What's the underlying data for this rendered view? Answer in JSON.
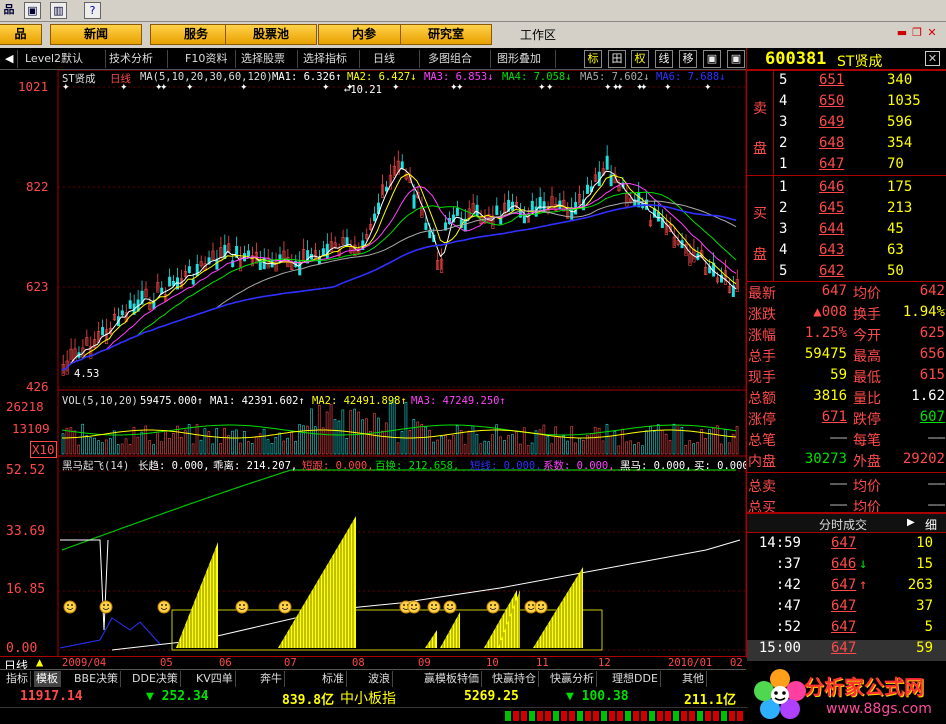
{
  "topbar": {
    "tools": [
      "品",
      "▣",
      "▥",
      "?"
    ]
  },
  "menu": {
    "items": [
      "新闻",
      "服务",
      "股票池",
      "内参",
      "研究室"
    ],
    "workarea": "工作区",
    "left_fragment": "品",
    "win_controls": [
      "▬",
      "❐",
      "✕"
    ]
  },
  "toolbar": {
    "items": [
      "Level2默认",
      "技术分析",
      "F10资料",
      "选择股票",
      "选择指标",
      "日线",
      "多图组合",
      "图形叠加"
    ],
    "squares": [
      "标",
      "田",
      "权",
      "线",
      "移",
      "▣",
      "▣"
    ]
  },
  "chart": {
    "main_legend": {
      "name": "ST贤成",
      "period": "日线",
      "ma_params": "MA(5,10,20,30,60,120)",
      "ma1": "MA1: 6.326↑",
      "ma2": "MA2: 6.427↓",
      "ma3": "MA3: 6.853↓",
      "ma4": "MA4: 7.058↓",
      "ma5": "MA5: 7.602↓",
      "ma6": "MA6: 7.688↓"
    },
    "price_axis": [
      "1021",
      "822",
      "623",
      "426"
    ],
    "hi_label": "←10.21",
    "lo_label": "4.53",
    "vol_legend": {
      "params": "VOL(5,10,20)",
      "value": "59475.000↑",
      "ma1": "MA1: 42391.602↑",
      "ma2": "MA2: 42491.898↑",
      "ma3": "MA3: 47249.250↑"
    },
    "vol_axis": [
      "26218",
      "13109",
      "X10"
    ],
    "ind_legend": {
      "name": "黑马起飞(14)",
      "a": "长趋: 0.000,",
      "b": "乖离: 214.207,",
      "c": "短跟: 0.000,",
      "d": "百换: 212.658,",
      "e": "短线: 0.000,",
      "f": "系数: 0.000,",
      "g": "黑马: 0.000,",
      "h": "买: 0.000"
    },
    "ind_axis": [
      "52.52",
      "33.69",
      "16.85",
      "0.00"
    ],
    "date_axis": [
      "日线",
      "2009/04",
      "05",
      "06",
      "07",
      "08",
      "09",
      "10",
      "11",
      "12",
      "2010/01",
      "02"
    ]
  },
  "quote": {
    "code": "600381",
    "name": "ST贤成",
    "sell": [
      {
        "n": "5",
        "p": "651",
        "v": "340"
      },
      {
        "n": "4",
        "p": "650",
        "v": "1035"
      },
      {
        "n": "3",
        "p": "649",
        "v": "596"
      },
      {
        "n": "2",
        "p": "648",
        "v": "354"
      },
      {
        "n": "1",
        "p": "647",
        "v": "70"
      }
    ],
    "buy": [
      {
        "n": "1",
        "p": "646",
        "v": "175"
      },
      {
        "n": "2",
        "p": "645",
        "v": "213"
      },
      {
        "n": "3",
        "p": "644",
        "v": "45"
      },
      {
        "n": "4",
        "p": "643",
        "v": "63"
      },
      {
        "n": "5",
        "p": "642",
        "v": "50"
      }
    ],
    "sell_label": [
      "卖",
      "盘"
    ],
    "buy_label": [
      "买",
      "盘"
    ],
    "stats": [
      {
        "l1": "最新",
        "v1": "647",
        "l2": "均价",
        "v2": "642"
      },
      {
        "l1": "涨跌",
        "v1": "▲008",
        "l2": "换手",
        "v2": "1.94%"
      },
      {
        "l1": "涨幅",
        "v1": "1.25%",
        "l2": "今开",
        "v2": "625"
      },
      {
        "l1": "总手",
        "v1": "59475",
        "l2": "最高",
        "v2": "656"
      },
      {
        "l1": "现手",
        "v1": "59",
        "l2": "最低",
        "v2": "615"
      },
      {
        "l1": "总额",
        "v1": "3816",
        "l2": "量比",
        "v2": "1.62"
      },
      {
        "l1": "涨停",
        "v1": "671",
        "l2": "跌停",
        "v2": "607"
      },
      {
        "l1": "总笔",
        "v1": "——",
        "l2": "每笔",
        "v2": "——"
      },
      {
        "l1": "内盘",
        "v1": "30273",
        "l2": "外盘",
        "v2": "29202"
      },
      {
        "l1": "总卖",
        "v1": "——",
        "l2": "均价",
        "v2": "——"
      },
      {
        "l1": "总买",
        "v1": "——",
        "l2": "均价",
        "v2": "——"
      }
    ],
    "ticks_title": "分时成交",
    "ticks_btn": "细",
    "ticks": [
      {
        "t": "14:59",
        "p": "647",
        "v": "10",
        "a": ""
      },
      {
        "t": ":37",
        "p": "646",
        "v": "15",
        "a": "↓"
      },
      {
        "t": ":42",
        "p": "647",
        "v": "263",
        "a": "↑"
      },
      {
        "t": ":47",
        "p": "647",
        "v": "37",
        "a": ""
      },
      {
        "t": ":52",
        "p": "647",
        "v": "5",
        "a": ""
      },
      {
        "t": "15:00",
        "p": "647",
        "v": "59",
        "a": ""
      }
    ]
  },
  "bottom_tabs": [
    "指标",
    "模板",
    "BBE决策",
    "DDE决策",
    "KV四单",
    "奔牛",
    "标准",
    "波浪",
    "赢模板特価",
    "快赢持仓",
    "快赢分析",
    "理想DDE",
    "其他"
  ],
  "index_bar": {
    "sh": "11917.14",
    "sh_chg": "▼ 252.34",
    "amount1": "839.8亿",
    "name2": "中小板指",
    "sz": "5269.25",
    "sz_chg": "▼ 100.38",
    "amount2": "211.1亿"
  },
  "logo": {
    "text": "分析家公式网",
    "url": "www.88gs.com"
  },
  "colors": {
    "up": "#ff4a4a",
    "down": "#00e000",
    "accent": "#ffff00"
  }
}
